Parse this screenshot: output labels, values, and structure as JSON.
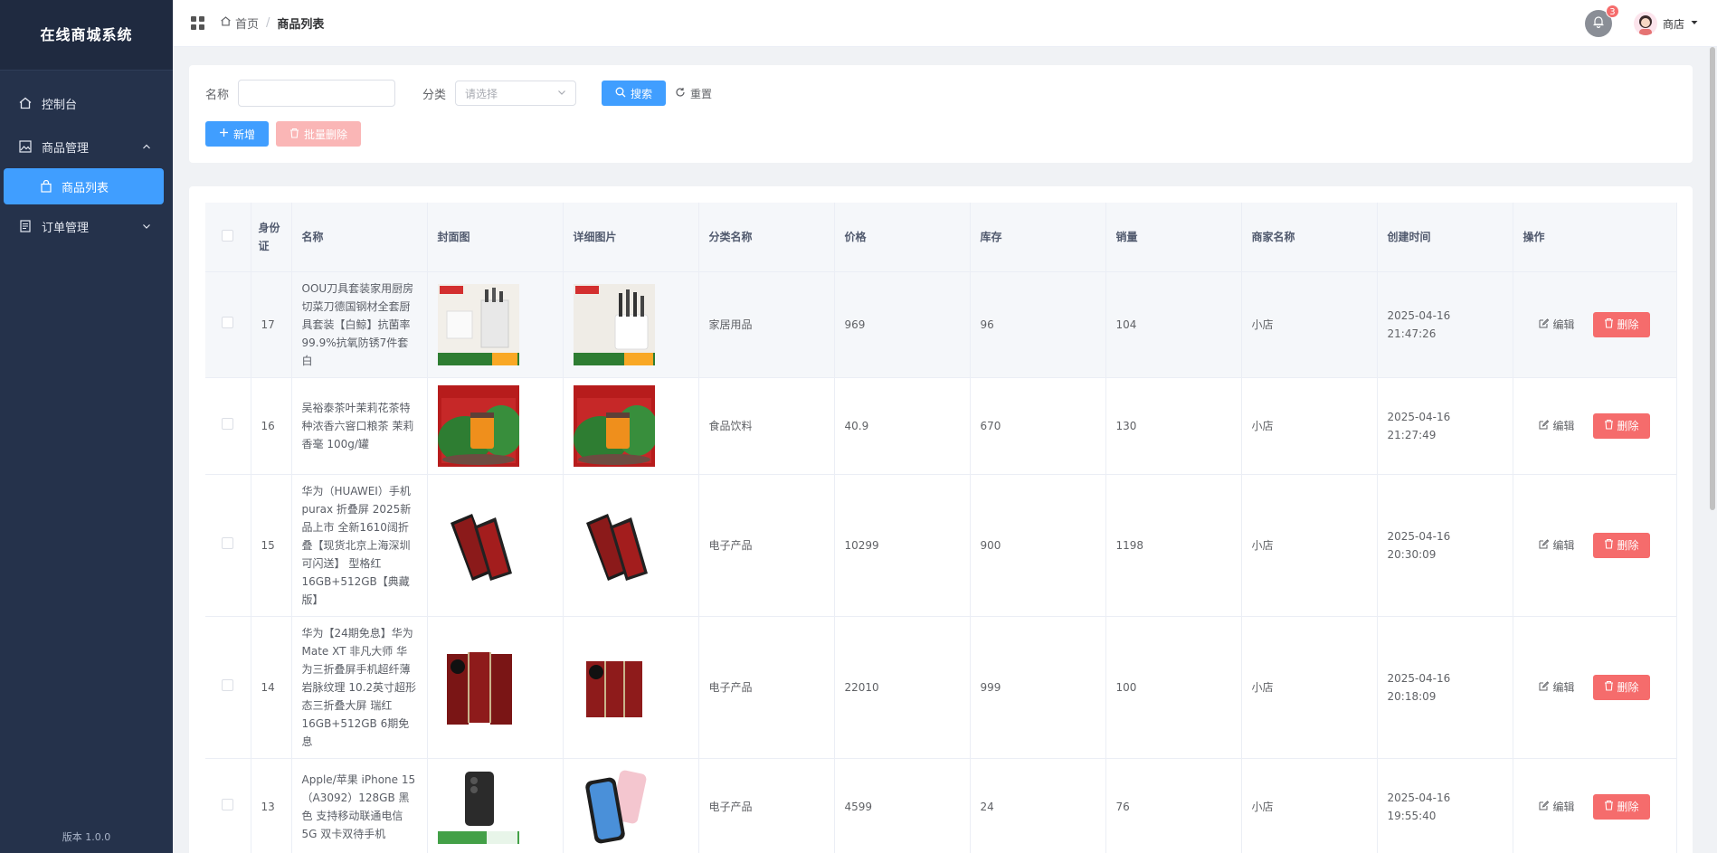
{
  "sidebar": {
    "brand": "在线商城系统",
    "items": [
      {
        "label": "控制台"
      },
      {
        "label": "商品管理"
      },
      {
        "label": "商品列表"
      },
      {
        "label": "订单管理"
      }
    ],
    "version": "版本 1.0.0"
  },
  "header": {
    "breadcrumb_home": "首页",
    "breadcrumb_current": "商品列表",
    "notification_count": "3",
    "user_name": "商店"
  },
  "search": {
    "name_label": "名称",
    "name_value": "",
    "category_label": "分类",
    "category_placeholder": "请选择",
    "search_button": "搜索",
    "reset_button": "重置",
    "add_button": "新增",
    "batch_delete_button": "批量删除"
  },
  "table": {
    "columns": [
      "身份证",
      "名称",
      "封面图",
      "详细图片",
      "分类名称",
      "价格",
      "库存",
      "销量",
      "商家名称",
      "创建时间",
      "操作"
    ],
    "edit_label": "编辑",
    "delete_label": "删除",
    "rows": [
      {
        "id": "17",
        "name": "OOU刀具套装家用厨房切菜刀德国钢材全套厨具套装【白鲸】抗菌率99.9%抗氧防锈7件套白",
        "category": "家居用品",
        "price": "969",
        "stock": "96",
        "sales": "104",
        "shop": "小店",
        "created": "2025-04-16 21:47:26"
      },
      {
        "id": "16",
        "name": "吴裕泰茶叶茉莉花茶特种浓香六窨口粮茶 茉莉香毫 100g/罐",
        "category": "食品饮料",
        "price": "40.9",
        "stock": "670",
        "sales": "130",
        "shop": "小店",
        "created": "2025-04-16 21:27:49"
      },
      {
        "id": "15",
        "name": "华为（HUAWEI）手机 purax 折叠屏 2025新品上市 全新1610阔折叠【现货北京上海深圳可闪送】 型格红 16GB+512GB【典藏版】",
        "category": "电子产品",
        "price": "10299",
        "stock": "900",
        "sales": "1198",
        "shop": "小店",
        "created": "2025-04-16 20:30:09"
      },
      {
        "id": "14",
        "name": "华为【24期免息】华为Mate XT 非凡大师 华为三折叠屏手机超纤薄岩脉纹理 10.2英寸超形态三折叠大屏 瑞红 16GB+512GB 6期免息",
        "category": "电子产品",
        "price": "22010",
        "stock": "999",
        "sales": "100",
        "shop": "小店",
        "created": "2025-04-16 20:18:09"
      },
      {
        "id": "13",
        "name": "Apple/苹果 iPhone 15（A3092）128GB 黑色 支持移动联通电信5G 双卡双待手机",
        "category": "电子产品",
        "price": "4599",
        "stock": "24",
        "sales": "76",
        "shop": "小店",
        "created": "2025-04-16 19:55:40"
      }
    ]
  },
  "colors": {
    "sidebar_bg": "#25324b",
    "primary": "#409eff",
    "danger": "#f56c6c"
  }
}
